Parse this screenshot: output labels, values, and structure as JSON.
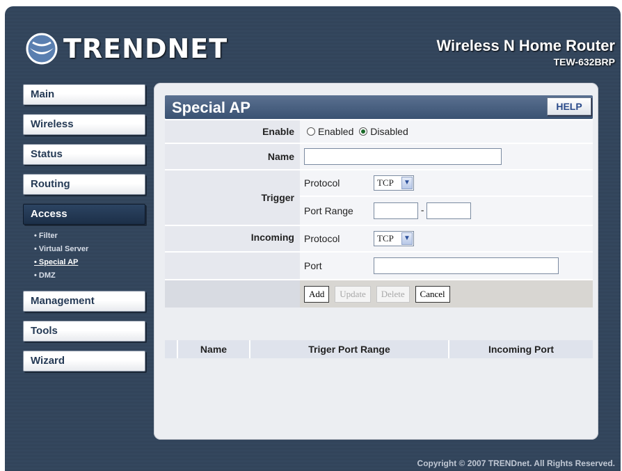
{
  "brand": {
    "logo_text": "TRENDNET",
    "product": "Wireless N Home Router",
    "model": "TEW-632BRP"
  },
  "nav": [
    {
      "label": "Main"
    },
    {
      "label": "Wireless"
    },
    {
      "label": "Status"
    },
    {
      "label": "Routing"
    },
    {
      "label": "Access"
    },
    {
      "label": "Management"
    },
    {
      "label": "Tools"
    },
    {
      "label": "Wizard"
    }
  ],
  "subnav": [
    "• Filter",
    "• Virtual Server",
    "• Special AP",
    "• DMZ"
  ],
  "page": {
    "title": "Special AP",
    "help": "HELP"
  },
  "form": {
    "enable_label": "Enable",
    "enabled_option": "Enabled",
    "disabled_option": "Disabled",
    "name_label": "Name",
    "name_value": "",
    "trigger_label": "Trigger",
    "incoming_label": "Incoming",
    "protocol_label": "Protocol",
    "port_range_label": "Port Range",
    "port_label": "Port",
    "trigger_protocol": "TCP",
    "incoming_protocol": "TCP",
    "range_separator": "-"
  },
  "buttons": {
    "add": "Add",
    "update": "Update",
    "delete": "Delete",
    "cancel": "Cancel"
  },
  "list": {
    "col_name": "Name",
    "col_trigger": "Triger Port Range",
    "col_incoming": "Incoming Port"
  },
  "footer": "Copyright © 2007 TRENDnet. All Rights Reserved."
}
